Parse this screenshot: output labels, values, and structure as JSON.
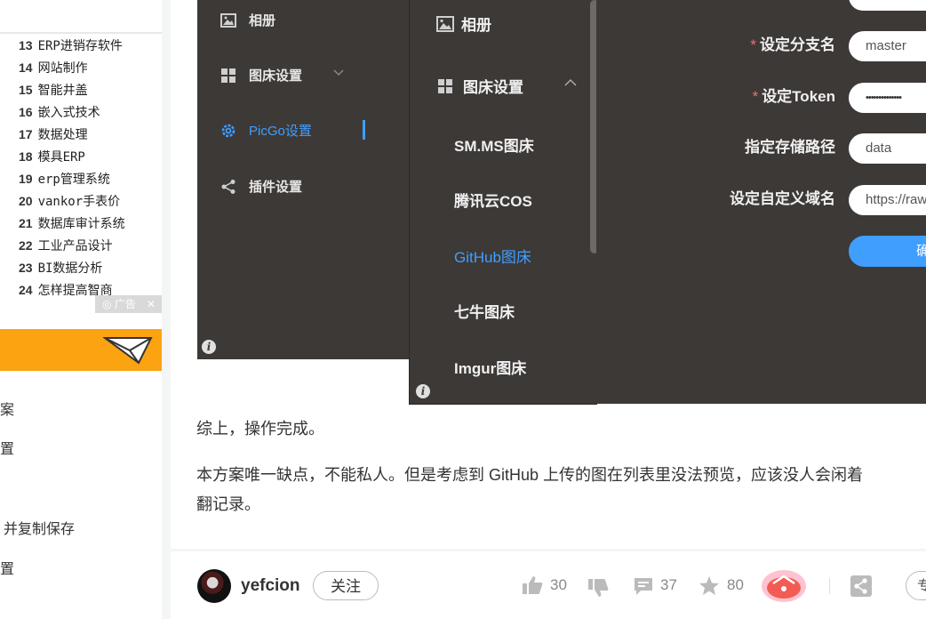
{
  "sidebar": {
    "hot_list": [
      {
        "num": "13",
        "text": "ERP进销存软件"
      },
      {
        "num": "14",
        "text": "网站制作"
      },
      {
        "num": "15",
        "text": "智能井盖"
      },
      {
        "num": "16",
        "text": "嵌入式技术"
      },
      {
        "num": "17",
        "text": "数据处理"
      },
      {
        "num": "18",
        "text": "模具ERP"
      },
      {
        "num": "19",
        "text": "erp管理系统"
      },
      {
        "num": "20",
        "text": "vankor手表价"
      },
      {
        "num": "21",
        "text": "数据库审计系统"
      },
      {
        "num": "22",
        "text": "工业产品设计"
      },
      {
        "num": "23",
        "text": "BI数据分析"
      },
      {
        "num": "24",
        "text": "怎样提高智商"
      }
    ],
    "ad_label": "广告",
    "ad_close": "✕",
    "toc_fragments": [
      "案",
      "置",
      "并复制保存",
      "置"
    ]
  },
  "picgo_main": {
    "nav": [
      "相册",
      "图床设置",
      "PicGo设置",
      "插件设置"
    ]
  },
  "picgo_panel": {
    "title_album": "相册",
    "title_settings": "图床设置",
    "items": [
      "SM.MS图床",
      "腾讯云COS",
      "GitHub图床",
      "七牛图床",
      "Imgur图床"
    ]
  },
  "picgo_form": {
    "fields": [
      {
        "label": "设定分支名",
        "value": "master"
      },
      {
        "label": "设定Token",
        "value": "••••••••••••••"
      },
      {
        "label": "指定存储路径",
        "value": "data"
      },
      {
        "label": "设定自定义域名",
        "value": "https://raw"
      }
    ],
    "required_mark": "*",
    "submit_label": "确"
  },
  "article": {
    "p1": "综上，操作完成。",
    "p2_line1": "本方案唯一缺点，不能私人。但是考虑到 GitHub 上传的图在列表里没法预览，应该没人会闲着",
    "p2_line2": "翻记录。"
  },
  "footer": {
    "author": "yefcion",
    "follow": "关注",
    "likes": "30",
    "comments": "37",
    "collects": "80",
    "pill": "专"
  },
  "colors": {
    "accent": "#409eff",
    "dark_bg": "#3d3937",
    "orange": "#fca312",
    "required": "#f56c6c"
  }
}
